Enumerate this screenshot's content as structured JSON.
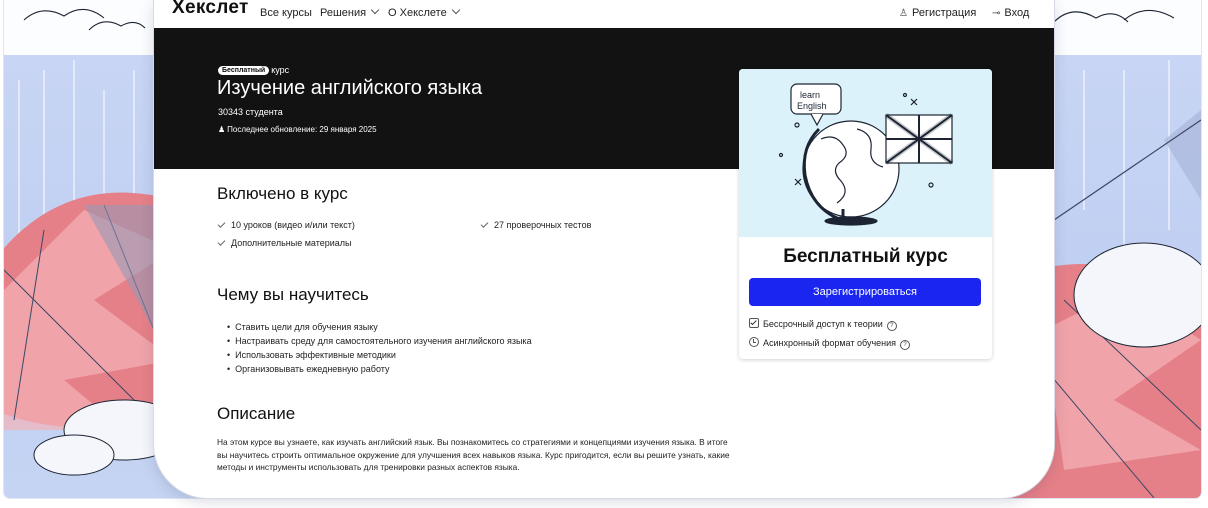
{
  "nav": {
    "logo": "Хекслет",
    "links": [
      "Все курсы",
      "Решения",
      "О Хекслете"
    ],
    "register_label": "Регистрация",
    "login_label": "Вход"
  },
  "hero": {
    "badge": "Бесплатный",
    "badge_suffix": "курс",
    "title": "Изучение английского языка",
    "students": "30343 студента",
    "updated": "Последнее обновление: 29 января 2025"
  },
  "included": {
    "title": "Включено в курс",
    "items": [
      "10 уроков (видео и/или текст)",
      "27 проверочных тестов",
      "Дополнительные материалы"
    ]
  },
  "learn": {
    "title": "Чему вы научитесь",
    "items": [
      "Ставить цели для обучения языку",
      "Настраивать среду для самостоятельного изучения английского языка",
      "Использовать эффективные методики",
      "Организовывать ежедневную работу"
    ]
  },
  "description": {
    "title": "Описание",
    "text": "На этом курсе вы узнаете, как изучать английский язык. Вы познакомитесь со стратегиями и концепциями изучения языка. В итоге вы научитесь строить оптимальное окружение для улучшения всех навыков языка. Курс пригодится, если вы решите узнать, какие методы и инструменты использовать для тренировки разных аспектов языка."
  },
  "sidebar": {
    "illustration_text": "learn English",
    "title": "Бесплатный курс",
    "button_label": "Зарегистрироваться",
    "features": [
      "Бессрочный доступ к теории",
      "Асинхронный формат обучения"
    ]
  },
  "colors": {
    "accent": "#1a26f0",
    "hero_bg": "#121212",
    "page_bg": "#c8d5f4"
  },
  "icons": {
    "register": "person-icon",
    "login": "key-icon",
    "check": "check-icon",
    "help": "question-circle-icon"
  }
}
